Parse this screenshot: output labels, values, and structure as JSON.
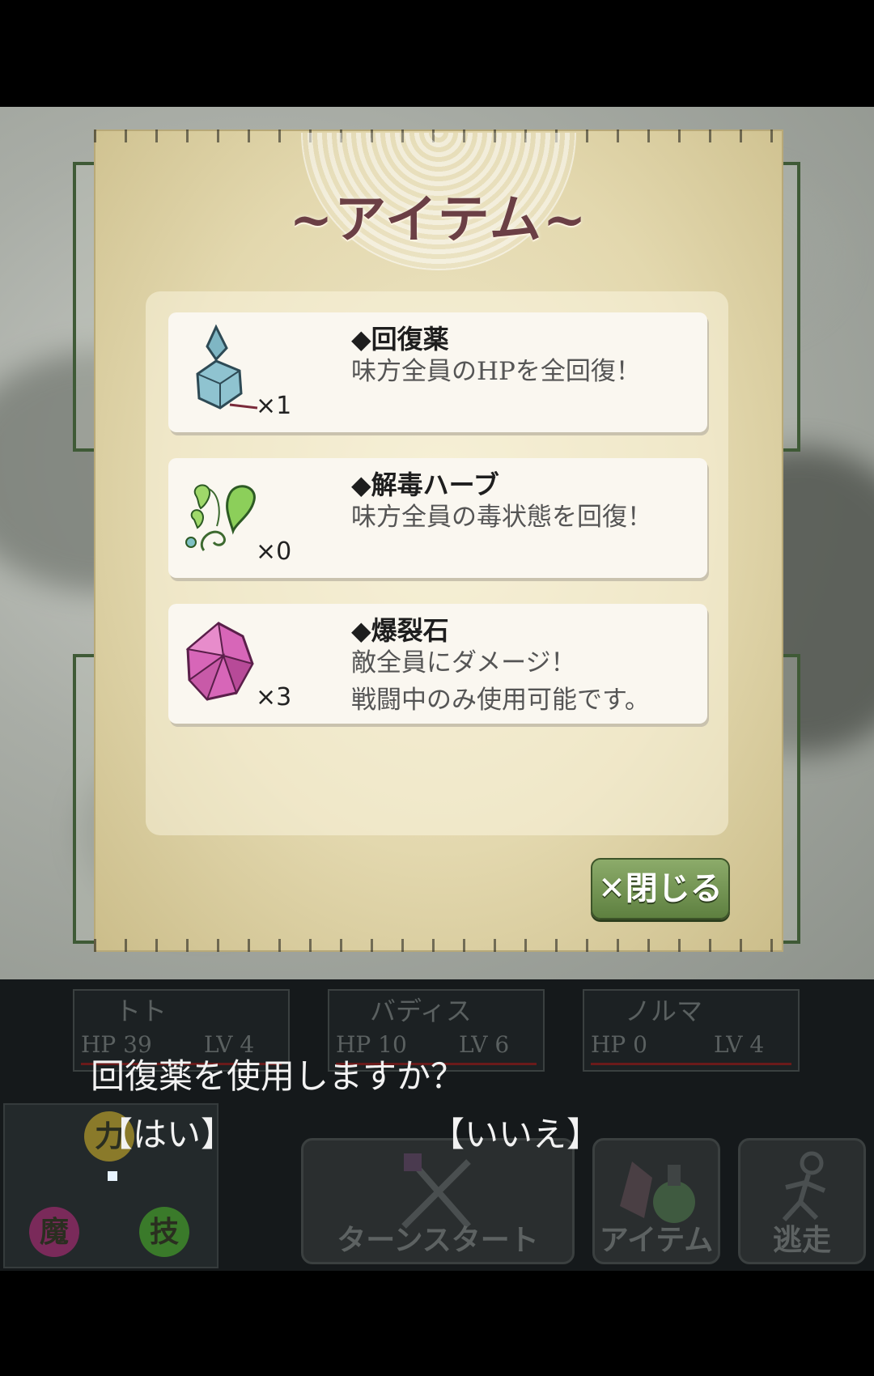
{
  "dialog": {
    "title": "~アイテム~",
    "items": [
      {
        "name": "◆回復薬",
        "desc": "味方全員のHPを全回復！",
        "qty": "×1",
        "icon": "potion-bottle-icon"
      },
      {
        "name": "◆解毒ハーブ",
        "desc": "味方全員の毒状態を回復！",
        "qty": "×0",
        "icon": "herb-leaf-icon"
      },
      {
        "name": "◆爆裂石",
        "desc": "敵全員にダメージ！\n戦闘中のみ使用可能です。",
        "qty": "×3",
        "icon": "burst-crystal-icon"
      }
    ],
    "close_label": "✕閉じる"
  },
  "party": [
    {
      "name": "トト",
      "hp_label": "HP",
      "hp": "39",
      "lv_label": "LV",
      "lv": "4"
    },
    {
      "name": "バディス",
      "hp_label": "HP",
      "hp": "10",
      "lv_label": "LV",
      "lv": "6"
    },
    {
      "name": "ノルマ",
      "hp_label": "HP",
      "hp": "0",
      "lv_label": "LV",
      "lv": "4"
    }
  ],
  "confirm": {
    "question": "回復薬を使用しますか？",
    "yes": "【はい】",
    "no": "【いいえ】"
  },
  "commands": {
    "turn_start": "ターンスタート",
    "item": "アイテム",
    "escape": "逃走"
  },
  "affinity_wheel": {
    "power": "力",
    "magic": "魔",
    "skill": "技"
  },
  "colors": {
    "title": "#6b3f45",
    "close_button": "#6f9350",
    "hp_bar": "#6a1a1a"
  }
}
